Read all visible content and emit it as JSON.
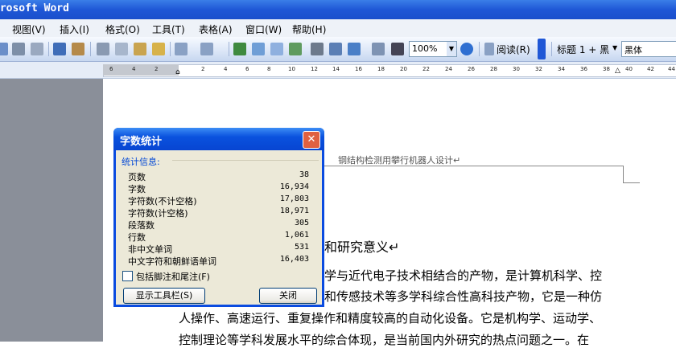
{
  "window": {
    "title": "crosoft Word"
  },
  "menu": [
    "视图(V)",
    "插入(I)",
    "格式(O)",
    "工具(T)",
    "表格(A)",
    "窗口(W)",
    "帮助(H)"
  ],
  "toolbar": {
    "zoom": "100%",
    "read_label": "阅读(R)",
    "style": "标题 1 + 黑",
    "font": "黑体"
  },
  "ruler": {
    "ticks": [
      "6",
      "4",
      "2",
      "2",
      "4",
      "6",
      "8",
      "10",
      "12",
      "14",
      "16",
      "18",
      "20",
      "22",
      "24",
      "26",
      "28",
      "30",
      "32",
      "34",
      "36",
      "38",
      "40",
      "42",
      "44"
    ]
  },
  "document": {
    "header": "钢结构检测用攀行机器人设计↵",
    "heading": "和研究意义↵",
    "lines": [
      "学与近代电子技术相结合的产物，是计算机科学、控",
      "和传感技术等多学科综合性高科技产物，它是一种仿",
      "人操作、高速运行、重复操作和精度较高的自动化设备。它是机构学、运动学、",
      "控制理论等学科发展水平的综合体现，是当前国内外研究的热点问题之一。在"
    ]
  },
  "dialog": {
    "title": "字数统计",
    "group_label": "统计信息:",
    "stats": [
      {
        "name": "页数",
        "value": "38"
      },
      {
        "name": "字数",
        "value": "16,934"
      },
      {
        "name": "字符数(不计空格)",
        "value": "17,803"
      },
      {
        "name": "字符数(计空格)",
        "value": "18,971"
      },
      {
        "name": "段落数",
        "value": "305"
      },
      {
        "name": "行数",
        "value": "1,061"
      },
      {
        "name": "非中文单词",
        "value": "531"
      },
      {
        "name": "中文字符和朝鲜语单词",
        "value": "16,403"
      }
    ],
    "checkbox_label": "包括脚注和尾注(F)",
    "show_toolbar_button": "显示工具栏(S)",
    "close_button": "关闭"
  }
}
